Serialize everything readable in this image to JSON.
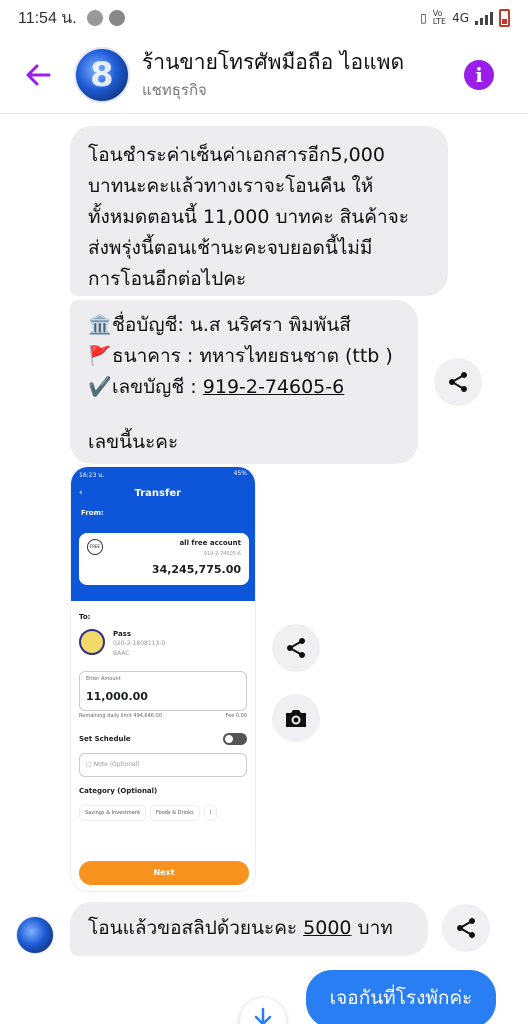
{
  "status_bar": {
    "time": "11:54 น.",
    "network": "4G"
  },
  "header": {
    "title": "ร้านขายโทรศัพมือถือ ไอแพด",
    "subtitle": "แชทธุรกิจ",
    "info_label": "i"
  },
  "messages": {
    "m1_lines": [
      "โอนชำระค่าเซ็นค่าเอกสารอีก5,000",
      "บาทนะคะแล้วทางเราจะโอนคืน ให้",
      "ทั้งหมดตอนนี้ 11,000 บาทคะ สินค้าจะ",
      "ส่งพรุ่งนี้ตอนเช้านะคะจบยอดนี้ไม่มี",
      "การโอนอีกต่อไปคะ"
    ],
    "m2": {
      "name_icon": "🏛️",
      "name_line": "ชื่อบัญชี:  น.ส นริศรา พิมพันสี",
      "bank_icon": "🚩",
      "bank_line": "ธนาคาร : ทหารไทยธนชาต (ttb )",
      "acct_icon": "✔️",
      "acct_label": "เลขบัญชี : ",
      "acct_no": "919-2-74605-6",
      "footer": "เลขนี้นะคะ"
    },
    "m3_prefix": "โอนแล้วขอสลิปด้วยนะคะ ",
    "m3_amount": "5000",
    "m3_suffix": " บาท",
    "m4": "เจอกันที่โรงพักค่ะ"
  },
  "screenshot": {
    "status_time": "16:23 น.",
    "status_right": "45%",
    "title": "Transfer",
    "from_label": "From:",
    "from_logo": "FREE",
    "from_name": "all free account",
    "from_number": "919-2-74605-6",
    "from_balance": "34,245,775.00",
    "to_label": "To:",
    "to_name": "Pass",
    "to_number": "020-2-1808113-0",
    "to_bank": "BAAC",
    "amount_label": "Enter Amount",
    "amount_value": "11,000.00",
    "limit_text": "Remaining daily limit 494,646.00",
    "fee_text": "Fee 0.00",
    "schedule_label": "Set Schedule",
    "note_placeholder": "Note (Optional)",
    "category_label": "Category (Optional)",
    "chips": [
      "Savings & Investment",
      "Foods & Drinks",
      "I"
    ],
    "next_label": "Next"
  },
  "icons": {
    "back": "arrow-left-icon",
    "share": "share-icon",
    "camera": "camera-icon",
    "down": "arrow-down-icon"
  },
  "colors": {
    "accent": "#9b1dea",
    "own_bubble": "#2a7ef3",
    "other_bubble": "#ededef"
  }
}
